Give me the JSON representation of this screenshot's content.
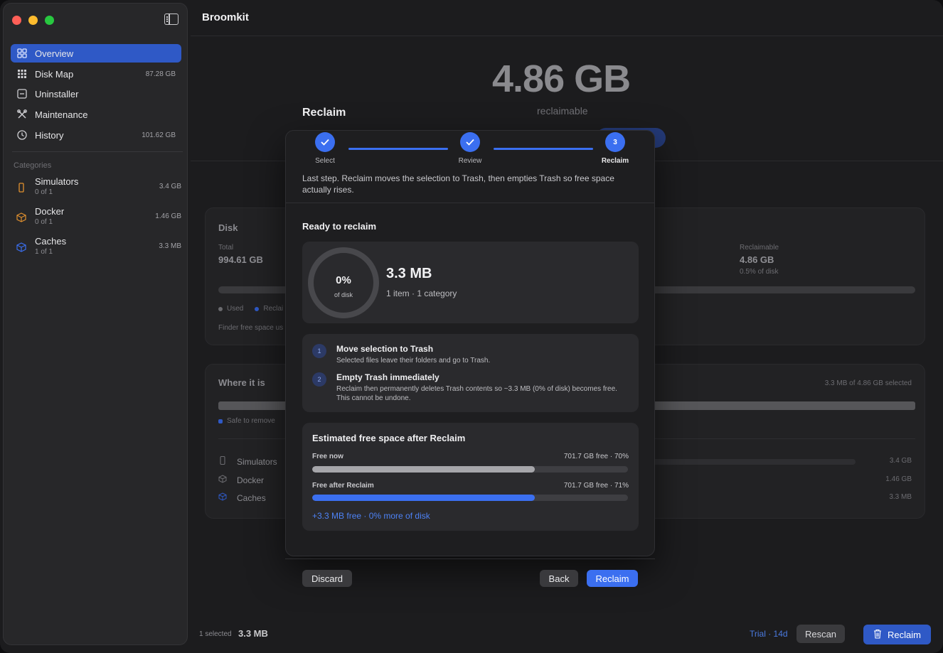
{
  "app": {
    "title": "Broomkit"
  },
  "sidebar": {
    "nav": [
      {
        "label": "Overview",
        "value": "",
        "icon": "grid-icon"
      },
      {
        "label": "Disk Map",
        "value": "87.28 GB",
        "icon": "squares-icon"
      },
      {
        "label": "Uninstaller",
        "value": "",
        "icon": "box-icon"
      },
      {
        "label": "Maintenance",
        "value": "",
        "icon": "wrench-icon"
      },
      {
        "label": "History",
        "value": "101.62 GB",
        "icon": "clock-icon"
      }
    ],
    "categories_title": "Categories",
    "categories": [
      {
        "name": "Simulators",
        "sub": "0 of 1",
        "value": "3.4 GB",
        "icon": "phone-icon",
        "color": "#e0902e"
      },
      {
        "name": "Docker",
        "sub": "0 of 1",
        "value": "1.46 GB",
        "icon": "cube-icon",
        "color": "#e0902e"
      },
      {
        "name": "Caches",
        "sub": "1 of 1",
        "value": "3.3 MB",
        "icon": "cube-icon",
        "color": "#3b6ff0"
      }
    ]
  },
  "hero": {
    "size": "4.86 GB",
    "sub": "reclaimable"
  },
  "disk": {
    "title": "Disk",
    "total_label": "Total",
    "total_value": "994.61 GB",
    "reclaimable_label": "Reclaimable",
    "reclaimable_value": "4.86 GB",
    "reclaimable_sub": "0.5% of disk",
    "legend_used": "Used",
    "legend_reclaim": "Reclai",
    "footnote": "Finder free space us"
  },
  "where": {
    "title": "Where it is",
    "selected": "3.3 MB of 4.86 GB selected",
    "legend_safe": "Safe to remove",
    "rows": [
      {
        "name": "Simulators",
        "value": "3.4 GB",
        "icon": "phone-icon"
      },
      {
        "name": "Docker",
        "value": "1.46 GB",
        "icon": "cube-icon"
      },
      {
        "name": "Caches",
        "value": "3.3 MB",
        "icon": "cube-icon"
      }
    ]
  },
  "bottom": {
    "selected_label": "1 selected",
    "selected_size": "3.3 MB",
    "trial": "Trial · 14d",
    "rescan": "Rescan",
    "reclaim": "Reclaim"
  },
  "modal": {
    "title": "Reclaim",
    "steps": [
      {
        "label": "Select",
        "state": "done"
      },
      {
        "label": "Review",
        "state": "done"
      },
      {
        "label": "Reclaim",
        "state": "active",
        "number": "3"
      }
    ],
    "description": "Last step. Reclaim moves the selection to Trash, then empties Trash so free space actually rises.",
    "ready_title": "Ready to reclaim",
    "ring_pct": "0%",
    "ring_sub": "of disk",
    "ready_size": "3.3 MB",
    "ready_sub": "1 item · 1 category",
    "actions": [
      {
        "num": "1",
        "title": "Move selection to Trash",
        "desc": "Selected files leave their folders and go to Trash."
      },
      {
        "num": "2",
        "title": "Empty Trash immediately",
        "desc": "Reclaim then permanently deletes Trash contents so ~3.3 MB (0% of disk) becomes free. This cannot be undone."
      }
    ],
    "estimate": {
      "title": "Estimated free space after Reclaim",
      "now_label": "Free now",
      "now_value": "701.7 GB free · 70%",
      "now_fraction": 0.705,
      "after_label": "Free after Reclaim",
      "after_value": "701.7 GB free · 71%",
      "after_fraction": 0.705,
      "delta": "+3.3 MB free · 0% more of disk"
    },
    "buttons": {
      "discard": "Discard",
      "back": "Back",
      "reclaim": "Reclaim"
    }
  },
  "colors": {
    "accent": "#3b6ff0",
    "sidebar_active": "#2f59c6",
    "warning": "#e0902e"
  }
}
